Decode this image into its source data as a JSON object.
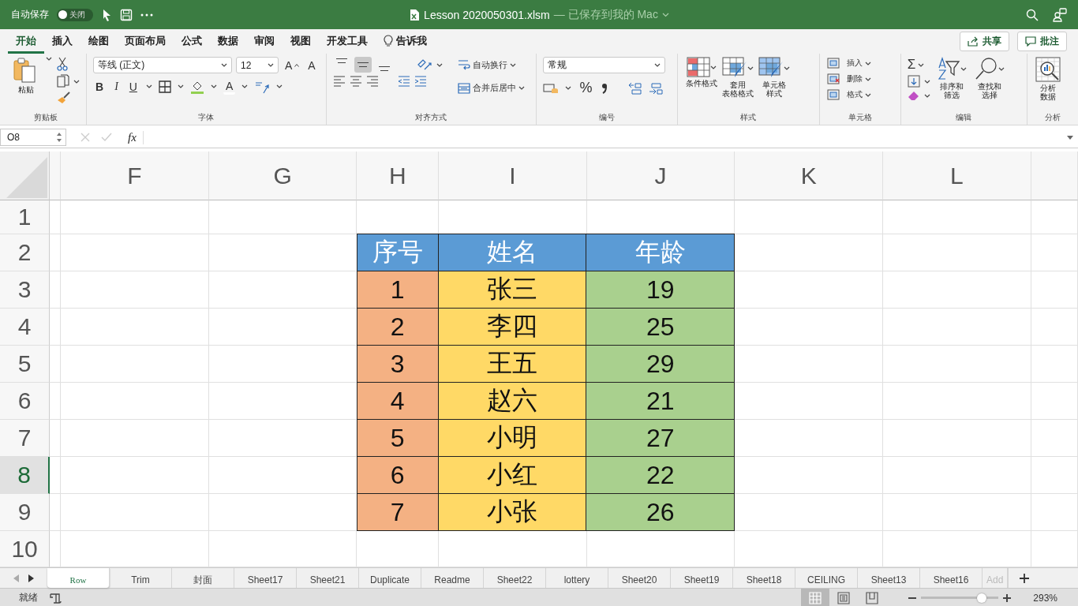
{
  "title_bar": {
    "autosave_label": "自动保存",
    "autosave_toggle": {
      "label": "关闭",
      "on": false
    },
    "file_name": "Lesson 2020050301.xlsm",
    "save_status": "— 已保存到我的 Mac"
  },
  "menu_tabs": [
    {
      "label": "开始",
      "selected": true
    },
    {
      "label": "插入",
      "selected": false
    },
    {
      "label": "绘图",
      "selected": false
    },
    {
      "label": "页面布局",
      "selected": false
    },
    {
      "label": "公式",
      "selected": false
    },
    {
      "label": "数据",
      "selected": false
    },
    {
      "label": "审阅",
      "selected": false
    },
    {
      "label": "视图",
      "selected": false
    },
    {
      "label": "开发工具",
      "selected": false
    },
    {
      "label": "告诉我",
      "selected": false,
      "kind": "tell"
    }
  ],
  "share_button": "共享",
  "comment_button": "批注",
  "ribbon": {
    "clipboard": {
      "paste": "粘贴",
      "label": "剪贴板"
    },
    "font": {
      "font_name": "等线 (正文)",
      "font_size": "12",
      "grow": "A",
      "shrink": "A",
      "bold": "B",
      "italic": "I",
      "underline": "U",
      "font_color": "A",
      "label": "字体"
    },
    "alignment": {
      "vertical": [
        {
          "selected": false
        },
        {
          "selected": true
        },
        {
          "selected": false
        }
      ],
      "wrap_text": "自动换行",
      "merge_center": "合并后居中",
      "label": "对齐方式"
    },
    "number": {
      "format": "常规",
      "percent": "%",
      "label": "编号"
    },
    "styles": {
      "buttons": [
        {
          "lines": [
            "条件格式"
          ]
        },
        {
          "lines": [
            "套用",
            "表格格式"
          ]
        },
        {
          "lines": [
            "单元格",
            "样式"
          ]
        }
      ],
      "label": "样式"
    },
    "cells": {
      "items": [
        "插入",
        "删除",
        "格式"
      ],
      "label": "单元格"
    },
    "editing": {
      "sum": "Σ",
      "buttons": [
        {
          "lines": [
            "排序和",
            "筛选"
          ]
        },
        {
          "lines": [
            "查找和",
            "选择"
          ]
        }
      ],
      "label": "编辑"
    },
    "analysis": {
      "button": {
        "lines": [
          "分析",
          "数据"
        ]
      },
      "label": "分析"
    }
  },
  "formula_bar": {
    "name_box": "O8",
    "fx": "fx"
  },
  "sheet": {
    "columns": [
      "F",
      "G",
      "H",
      "I",
      "J",
      "K",
      "L"
    ],
    "rows": [
      {
        "label": "1",
        "selected": false,
        "cells": [
          {},
          {},
          {},
          {},
          {},
          {},
          {}
        ]
      },
      {
        "label": "2",
        "selected": false,
        "cells": [
          {},
          {},
          {
            "text": "序号",
            "kind": "header",
            "color": "#5b9bd5"
          },
          {
            "text": "姓名",
            "kind": "header",
            "color": "#5b9bd5"
          },
          {
            "text": "年龄",
            "kind": "header",
            "color": "#5b9bd5"
          },
          {},
          {}
        ]
      },
      {
        "label": "3",
        "selected": false,
        "cells": [
          {},
          {},
          {
            "text": "1",
            "kind": "data",
            "color": "#f4b183"
          },
          {
            "text": "张三",
            "kind": "data",
            "color": "#ffd966"
          },
          {
            "text": "19",
            "kind": "data",
            "color": "#a9d08e"
          },
          {},
          {}
        ]
      },
      {
        "label": "4",
        "selected": false,
        "cells": [
          {},
          {},
          {
            "text": "2",
            "kind": "data",
            "color": "#f4b183"
          },
          {
            "text": "李四",
            "kind": "data",
            "color": "#ffd966"
          },
          {
            "text": "25",
            "kind": "data",
            "color": "#a9d08e"
          },
          {},
          {}
        ]
      },
      {
        "label": "5",
        "selected": false,
        "cells": [
          {},
          {},
          {
            "text": "3",
            "kind": "data",
            "color": "#f4b183"
          },
          {
            "text": "王五",
            "kind": "data",
            "color": "#ffd966"
          },
          {
            "text": "29",
            "kind": "data",
            "color": "#a9d08e"
          },
          {},
          {}
        ]
      },
      {
        "label": "6",
        "selected": false,
        "cells": [
          {},
          {},
          {
            "text": "4",
            "kind": "data",
            "color": "#f4b183"
          },
          {
            "text": "赵六",
            "kind": "data",
            "color": "#ffd966"
          },
          {
            "text": "21",
            "kind": "data",
            "color": "#a9d08e"
          },
          {},
          {}
        ]
      },
      {
        "label": "7",
        "selected": false,
        "cells": [
          {},
          {},
          {
            "text": "5",
            "kind": "data",
            "color": "#f4b183"
          },
          {
            "text": "小明",
            "kind": "data",
            "color": "#ffd966"
          },
          {
            "text": "27",
            "kind": "data",
            "color": "#a9d08e"
          },
          {},
          {}
        ]
      },
      {
        "label": "8",
        "selected": true,
        "cells": [
          {},
          {},
          {
            "text": "6",
            "kind": "data",
            "color": "#f4b183"
          },
          {
            "text": "小红",
            "kind": "data",
            "color": "#ffd966"
          },
          {
            "text": "22",
            "kind": "data",
            "color": "#a9d08e"
          },
          {},
          {}
        ]
      },
      {
        "label": "9",
        "selected": false,
        "cells": [
          {},
          {},
          {
            "text": "7",
            "kind": "data",
            "color": "#f4b183"
          },
          {
            "text": "小张",
            "kind": "data",
            "color": "#ffd966"
          },
          {
            "text": "26",
            "kind": "data",
            "color": "#a9d08e"
          },
          {},
          {}
        ]
      },
      {
        "label": "10",
        "selected": false,
        "cells": [
          {},
          {},
          {},
          {},
          {},
          {},
          {}
        ]
      }
    ]
  },
  "sheet_tabs": [
    {
      "label": "Row",
      "selected": true
    },
    {
      "label": "Trim",
      "selected": false
    },
    {
      "label": "封面",
      "selected": false
    },
    {
      "label": "Sheet17",
      "selected": false
    },
    {
      "label": "Sheet21",
      "selected": false
    },
    {
      "label": "Duplicate",
      "selected": false
    },
    {
      "label": "Readme",
      "selected": false
    },
    {
      "label": "Sheet22",
      "selected": false
    },
    {
      "label": "lottery",
      "selected": false
    },
    {
      "label": "Sheet20",
      "selected": false
    },
    {
      "label": "Sheet19",
      "selected": false
    },
    {
      "label": "Sheet18",
      "selected": false
    },
    {
      "label": "CEILING",
      "selected": false
    },
    {
      "label": "Sheet13",
      "selected": false
    },
    {
      "label": "Sheet16",
      "selected": false
    },
    {
      "label": "Add",
      "selected": false
    }
  ],
  "status_bar": {
    "status": "就绪",
    "views": [
      {
        "selected": true
      },
      {
        "selected": false
      },
      {
        "selected": false
      }
    ],
    "zoom": {
      "level": 0.78
    },
    "zoom_text": "293%"
  }
}
